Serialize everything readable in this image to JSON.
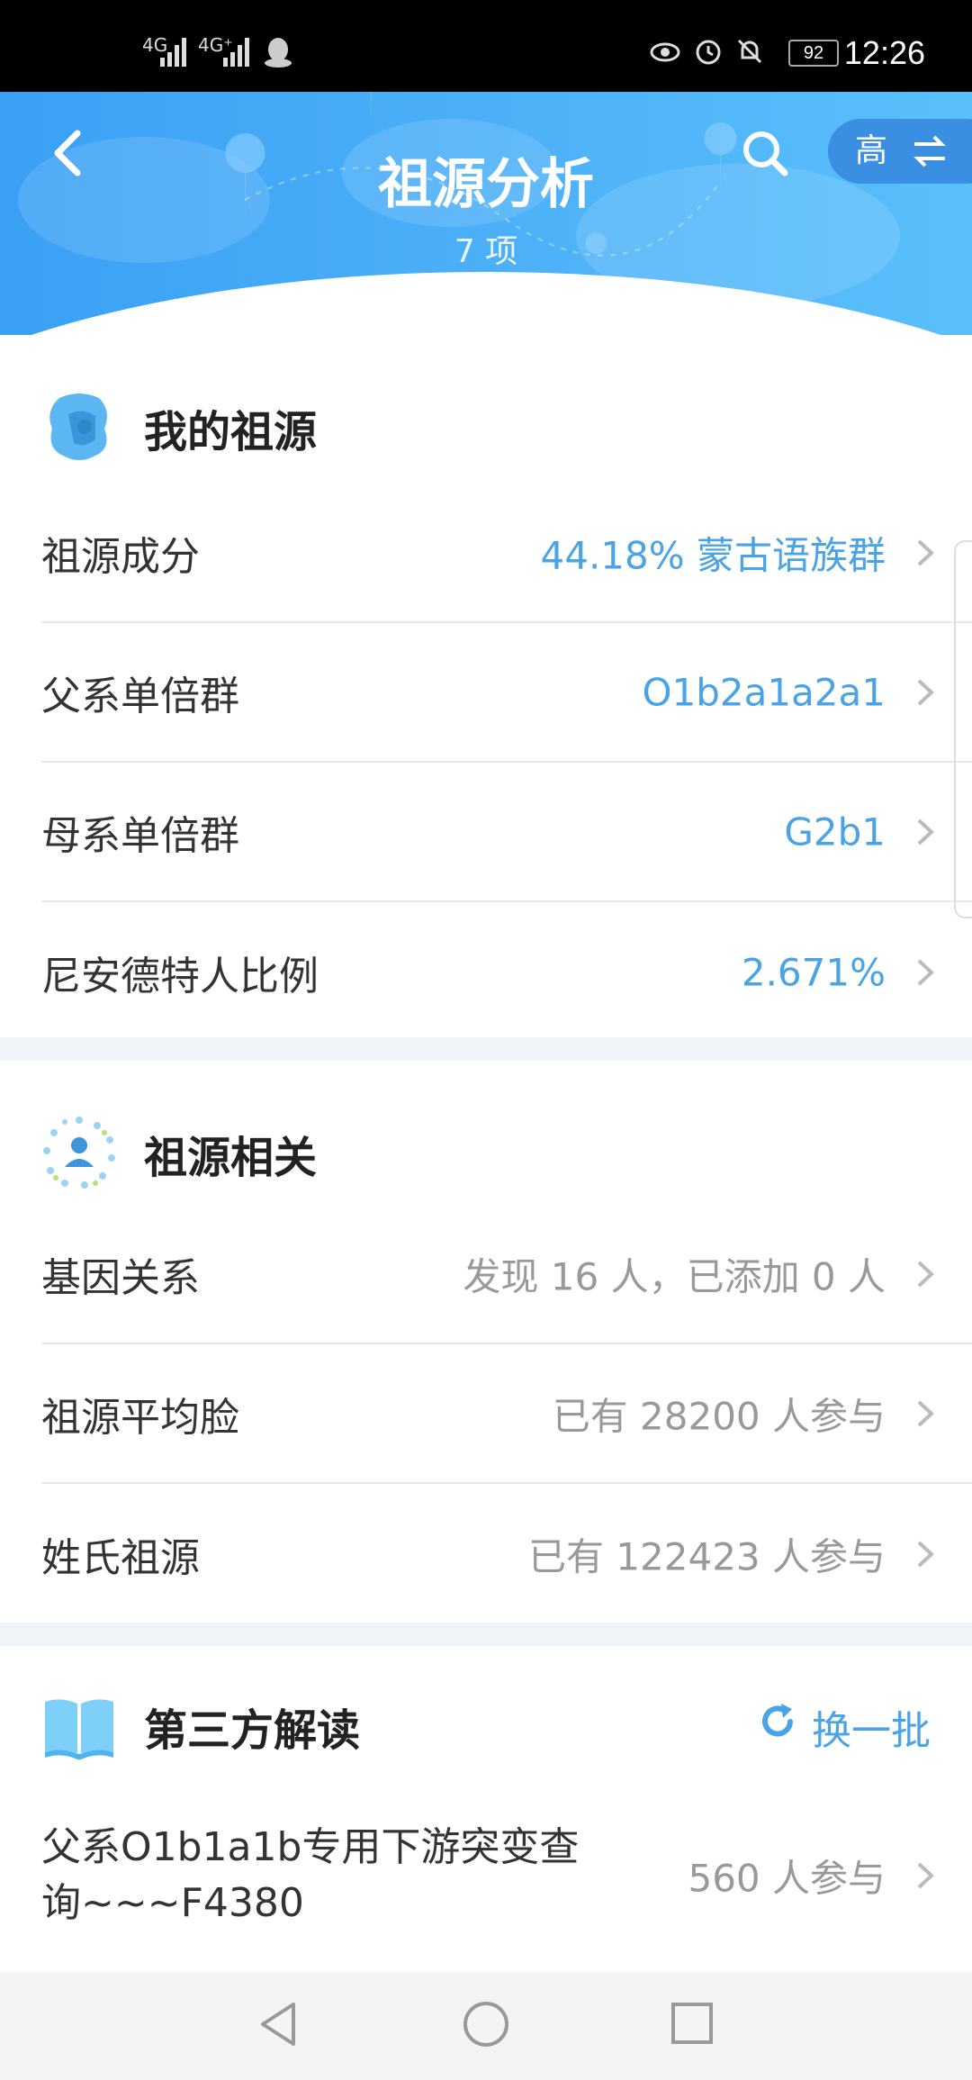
{
  "status_bar": {
    "signal_1": "4G",
    "signal_2": "4G⁺",
    "battery": "92",
    "time": "12:26"
  },
  "header": {
    "title": "祖源分析",
    "subtitle": "7 项",
    "quality_label": "高"
  },
  "my_ancestry": {
    "title": "我的祖源",
    "rows": [
      {
        "label": "祖源成分",
        "value": "44.18% 蒙古语族群"
      },
      {
        "label": "父系单倍群",
        "value": "O1b2a1a2a1"
      },
      {
        "label": "母系单倍群",
        "value": "G2b1"
      },
      {
        "label": "尼安德特人比例",
        "value": "2.671%"
      }
    ]
  },
  "ancestry_related": {
    "title": "祖源相关",
    "rows": [
      {
        "label": "基因关系",
        "value": "发现 16 人，已添加 0 人"
      },
      {
        "label": "祖源平均脸",
        "value": "已有 28200 人参与"
      },
      {
        "label": "姓氏祖源",
        "value": "已有 122423 人参与"
      }
    ]
  },
  "third_party": {
    "title": "第三方解读",
    "refresh_label": "换一批",
    "items": [
      {
        "label_line1": "父系O1b1a1b专用下游突变查",
        "label_line2": "询~~~F4380",
        "value": "560 人参与"
      }
    ]
  },
  "colors": {
    "accent": "#4aa3e6",
    "header_gradient_start": "#3aa0f5",
    "header_gradient_end": "#59c0fb"
  }
}
